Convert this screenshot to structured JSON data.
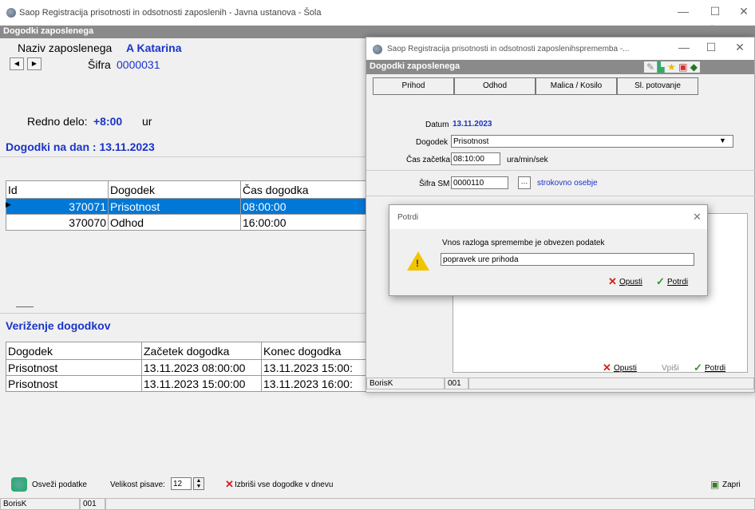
{
  "main": {
    "title": "Saop Registracija prisotnosti in odsotnosti zaposlenih - Javna ustanova - Šola",
    "banner": "Dogodki zaposlenega",
    "employee_label": "Naziv zaposlenega",
    "employee_name": "A Katarina",
    "code_label": "Šifra",
    "code_value": "0000031",
    "regular_label": "Redno delo:",
    "regular_value": "+8:00",
    "regular_unit": "ur",
    "events_title": "Dogodki na dan : 13.11.2023",
    "events_table": {
      "headers": [
        "Id",
        "Dogodek",
        "Čas dogodka"
      ],
      "rows": [
        [
          "370071",
          "Prisotnost",
          "08:00:00"
        ],
        [
          "370070",
          "Odhod",
          "16:00:00"
        ]
      ]
    },
    "chain_title": "Veriženje dogodkov",
    "chain_table": {
      "headers": [
        "Dogodek",
        "Začetek dogodka",
        "Konec dogodka"
      ],
      "rows": [
        [
          "Prisotnost",
          "13.11.2023 08:00:00",
          "13.11.2023 15:00:"
        ],
        [
          "Prisotnost",
          "13.11.2023 15:00:00",
          "13.11.2023 16:00:"
        ]
      ]
    },
    "refresh_label": "Osveži podatke",
    "font_size_label": "Velikost pisave:",
    "font_size_value": "12",
    "delete_all_label": "Izbriši vse dogodke v dnevu",
    "close_label": "Zapri",
    "status_user": "BorisK",
    "status_code": "001"
  },
  "edit_dialog": {
    "title": "Saop Registracija prisotnosti in odsotnosti zaposlenihsprememba -...",
    "banner": "Dogodki zaposlenega",
    "tabs": [
      "Prihod",
      "Odhod",
      "Malica / Kosilo",
      "Sl. potovanje"
    ],
    "date_label": "Datum",
    "date_value": "13.11.2023",
    "event_label": "Dogodek",
    "event_value": "Prisotnost",
    "start_label": "Čas začetka",
    "start_value": "08:10:00",
    "start_unit": "ura/min/sek",
    "sm_label": "Šifra SM",
    "sm_value": "0000110",
    "sm_desc": "strokovno osebje",
    "cancel_label": "Opusti",
    "write_label": "Vpiši",
    "confirm_label": "Potrdi",
    "status_user": "BorisK",
    "status_code": "001"
  },
  "confirm_dialog": {
    "title": "Potrdi",
    "message": "Vnos razloga spremembe je obvezen podatek",
    "reason_value": "popravek ure prihoda",
    "cancel_label": "Opusti",
    "confirm_label": "Potrdi"
  }
}
